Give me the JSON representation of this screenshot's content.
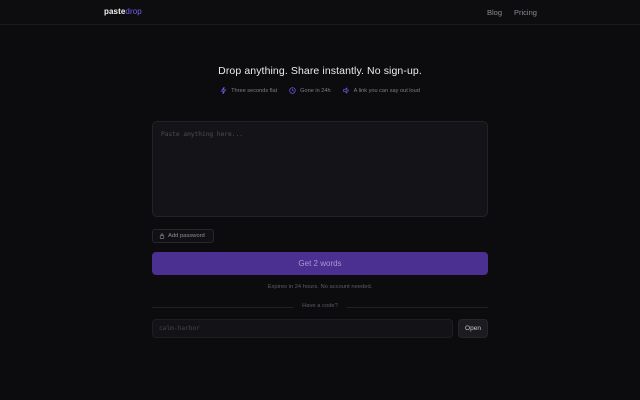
{
  "header": {
    "logo_part1": "paste",
    "logo_part2": "drop",
    "nav": [
      "Blog",
      "Pricing"
    ]
  },
  "hero": {
    "headline": "Drop anything. Share instantly. No sign-up.",
    "features": [
      {
        "icon": "lightning-icon",
        "label": "Three seconds flat"
      },
      {
        "icon": "clock-icon",
        "label": "Gone in 24h"
      },
      {
        "icon": "speaker-icon",
        "label": "A link you can say out loud"
      }
    ]
  },
  "paste": {
    "placeholder": "Paste anything here..."
  },
  "password_button": "Add password",
  "cta": "Get 2 words",
  "note": "Expires in 24 hours. No account needed.",
  "divider": "Have a code?",
  "code": {
    "placeholder": "calm-harbor",
    "open_label": "Open"
  },
  "colors": {
    "background": "#0c0c0f",
    "accent": "#7c5cf0",
    "cta_bg": "#4b2f91"
  }
}
